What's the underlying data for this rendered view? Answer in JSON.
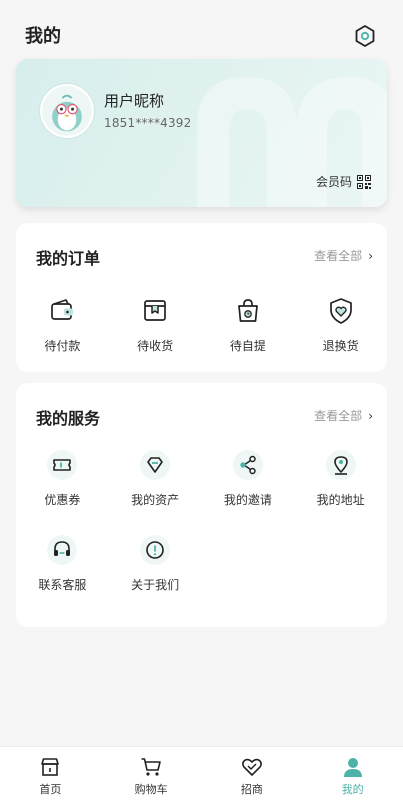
{
  "header": {
    "title": "我的"
  },
  "profile": {
    "nickname": "用户昵称",
    "phone": "1851****4392",
    "member_code_label": "会员码"
  },
  "orders": {
    "title": "我的订单",
    "view_all": "查看全部",
    "items": [
      {
        "label": "待付款",
        "icon": "wallet-icon"
      },
      {
        "label": "待收货",
        "icon": "package-box-icon"
      },
      {
        "label": "待自提",
        "icon": "shopping-bag-icon"
      },
      {
        "label": "退换货",
        "icon": "heart-shield-icon"
      }
    ]
  },
  "services": {
    "title": "我的服务",
    "view_all": "查看全部",
    "items": [
      {
        "label": "优惠券",
        "icon": "coupon-icon"
      },
      {
        "label": "我的资产",
        "icon": "diamond-icon"
      },
      {
        "label": "我的邀请",
        "icon": "share-icon"
      },
      {
        "label": "我的地址",
        "icon": "location-pin-icon"
      },
      {
        "label": "联系客服",
        "icon": "headset-icon"
      },
      {
        "label": "关于我们",
        "icon": "info-icon"
      }
    ]
  },
  "tabbar": {
    "items": [
      {
        "label": "首页",
        "icon": "home-store-icon",
        "active": false
      },
      {
        "label": "购物车",
        "icon": "cart-icon",
        "active": false
      },
      {
        "label": "招商",
        "icon": "heart-handshake-icon",
        "active": false
      },
      {
        "label": "我的",
        "icon": "person-icon",
        "active": true
      }
    ]
  },
  "colors": {
    "accent": "#4db3a8",
    "card_bg": "#d6eeec",
    "icon_fill": "#bfe3de",
    "page_bg": "#f6f6f6"
  }
}
